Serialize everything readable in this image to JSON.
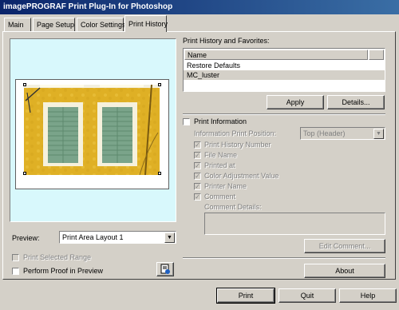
{
  "window": {
    "title": "imagePROGRAF Print Plug-In for Photoshop"
  },
  "tabs": [
    {
      "label": "Main"
    },
    {
      "label": "Page Setup"
    },
    {
      "label": "Color Settings"
    },
    {
      "label": "Print History",
      "active": true
    }
  ],
  "preview": {
    "label": "Preview:",
    "selected": "Print Area Layout 1",
    "print_selected_range": "Print Selected Range",
    "perform_proof": "Perform Proof in Preview"
  },
  "history": {
    "heading": "Print History and Favorites:",
    "column_name": "Name",
    "items": [
      "Restore Defaults",
      "MC_luster"
    ],
    "selected_index": 1,
    "apply_label": "Apply",
    "details_label": "Details..."
  },
  "print_info": {
    "label": "Print Information",
    "position_label": "Information Print Position:",
    "position_value": "Top (Header)",
    "options": [
      "Print History Number",
      "File Name",
      "Printed at",
      "Color Adjustment Value",
      "Printer Name",
      "Comment"
    ],
    "comment_details_label": "Comment Details:",
    "edit_comment_label": "Edit Comment..."
  },
  "about_label": "About",
  "footer": {
    "print_label": "Print",
    "quit_label": "Quit",
    "help_label": "Help"
  },
  "colors": {
    "title_bar": "#0a246a",
    "selection": "#d4d0c8",
    "preview_bg": "#d8f8fc"
  }
}
